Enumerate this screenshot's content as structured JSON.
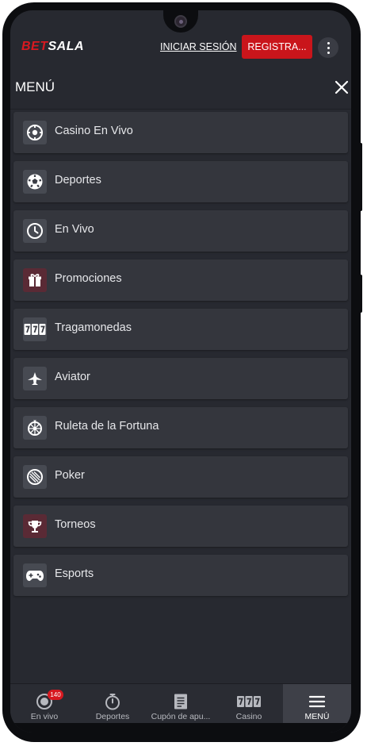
{
  "header": {
    "logo_bet": "BET",
    "logo_sala": "SALA",
    "login_label": "INICIAR SESIÓN",
    "register_label": "REGISTRA...",
    "more_icon": "kebab-icon"
  },
  "menu": {
    "title": "MENÚ",
    "close_icon": "close-icon",
    "items": [
      {
        "label": "Casino En Vivo",
        "icon": "casino-chip-icon"
      },
      {
        "label": "Deportes",
        "icon": "soccer-ball-icon"
      },
      {
        "label": "En Vivo",
        "icon": "clock-icon"
      },
      {
        "label": "Promociones",
        "icon": "gift-icon"
      },
      {
        "label": "Tragamonedas",
        "icon": "slot-777-icon"
      },
      {
        "label": "Aviator",
        "icon": "airplane-icon"
      },
      {
        "label": "Ruleta de la Fortuna",
        "icon": "wheel-icon"
      },
      {
        "label": "Poker",
        "icon": "poker-chip-icon"
      },
      {
        "label": "Torneos",
        "icon": "trophy-icon"
      },
      {
        "label": "Esports",
        "icon": "gamepad-icon"
      }
    ]
  },
  "bottom_nav": {
    "items": [
      {
        "label": "En vivo",
        "icon": "live-icon",
        "badge": "140"
      },
      {
        "label": "Deportes",
        "icon": "stopwatch-icon"
      },
      {
        "label": "Cupón de apu...",
        "icon": "coupon-icon"
      },
      {
        "label": "Casino",
        "icon": "slot-777-icon"
      },
      {
        "label": "MENÚ",
        "icon": "hamburger-icon",
        "active": true
      }
    ]
  },
  "colors": {
    "brand_red": "#d71920",
    "background": "#272930",
    "item_bg": "#34363d"
  }
}
